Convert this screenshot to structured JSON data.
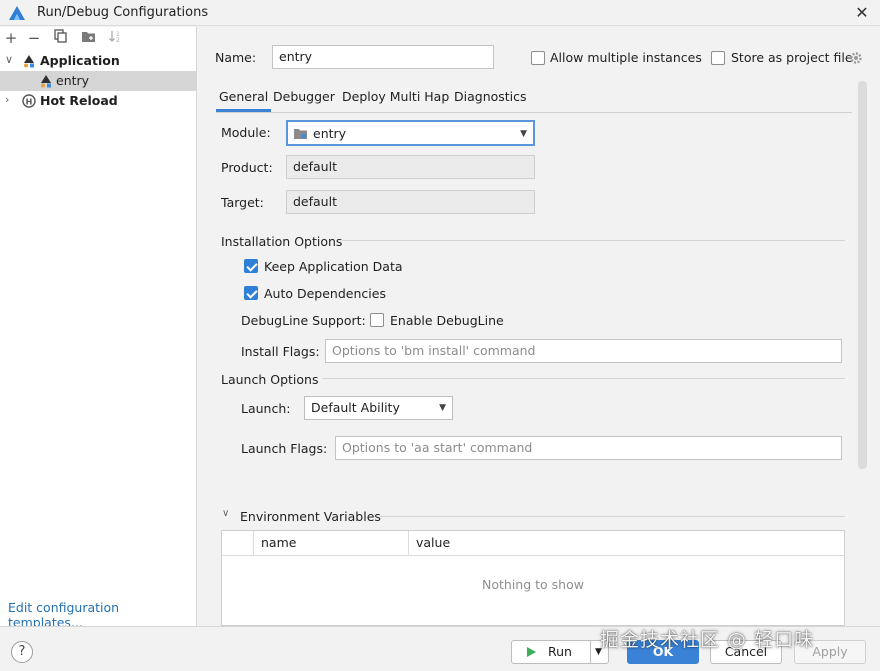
{
  "window": {
    "title": "Run/Debug Configurations",
    "close_icon": "close-icon"
  },
  "sidebar": {
    "toolbar": [
      "add-icon",
      "remove-icon",
      "copy-icon",
      "folder-icon",
      "sort-icon"
    ],
    "tree": [
      {
        "label": "Application",
        "icon": "application-icon",
        "expanded": true
      },
      {
        "label": "entry",
        "icon": "application-icon",
        "selected": true
      },
      {
        "label": "Hot Reload",
        "icon": "hot-reload-icon",
        "expanded": false
      }
    ],
    "edit_templates": "Edit configuration templates..."
  },
  "form": {
    "name_label": "Name:",
    "name_value": "entry",
    "allow_multiple": "Allow multiple instances",
    "store_as_project": "Store as project file",
    "tabs": [
      "General",
      "Debugger",
      "Deploy Multi Hap",
      "Diagnostics"
    ],
    "active_tab": "General",
    "module_label": "Module:",
    "module_value": "entry",
    "product_label": "Product:",
    "product_value": "default",
    "target_label": "Target:",
    "target_value": "default",
    "installation_options": "Installation Options",
    "keep_app_data": "Keep Application Data",
    "keep_app_data_checked": true,
    "auto_dependencies": "Auto Dependencies",
    "auto_dependencies_checked": true,
    "debugline_support": "DebugLine Support:",
    "enable_debugline": "Enable DebugLine",
    "enable_debugline_checked": false,
    "install_flags_label": "Install Flags:",
    "install_flags_placeholder": "Options to 'bm install' command",
    "launch_options": "Launch Options",
    "launch_label": "Launch:",
    "launch_value": "Default Ability",
    "launch_flags_label": "Launch Flags:",
    "launch_flags_placeholder": "Options to 'aa start' command",
    "env_vars": "Environment Variables",
    "env_columns": [
      "name",
      "value"
    ],
    "env_empty": "Nothing to show"
  },
  "footer": {
    "run": "Run",
    "ok": "OK",
    "cancel": "Cancel",
    "apply": "Apply",
    "help": "?",
    "watermark": "掘金技术社区 @ 轻口味"
  },
  "colors": {
    "accent": "#3a82d6",
    "link": "#2470b3",
    "run_green": "#3cae5a"
  }
}
